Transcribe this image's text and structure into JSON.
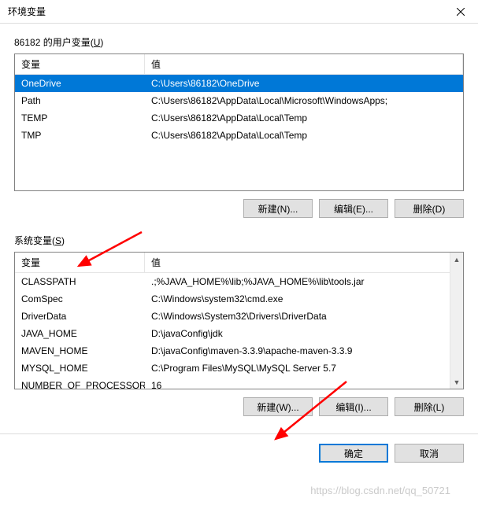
{
  "window": {
    "title": "环境变量"
  },
  "user_section": {
    "label_prefix": "86182 的用户变量(",
    "label_key": "U",
    "label_suffix": ")",
    "headers": {
      "name": "变量",
      "value": "值"
    },
    "rows": [
      {
        "name": "OneDrive",
        "value": "C:\\Users\\86182\\OneDrive",
        "selected": true
      },
      {
        "name": "Path",
        "value": "C:\\Users\\86182\\AppData\\Local\\Microsoft\\WindowsApps;",
        "selected": false
      },
      {
        "name": "TEMP",
        "value": "C:\\Users\\86182\\AppData\\Local\\Temp",
        "selected": false
      },
      {
        "name": "TMP",
        "value": "C:\\Users\\86182\\AppData\\Local\\Temp",
        "selected": false
      }
    ],
    "buttons": {
      "new": "新建(N)...",
      "edit": "编辑(E)...",
      "delete": "删除(D)"
    }
  },
  "system_section": {
    "label_prefix": "系统变量(",
    "label_key": "S",
    "label_suffix": ")",
    "headers": {
      "name": "变量",
      "value": "值"
    },
    "rows": [
      {
        "name": "CLASSPATH",
        "value": ".;%JAVA_HOME%\\lib;%JAVA_HOME%\\lib\\tools.jar"
      },
      {
        "name": "ComSpec",
        "value": "C:\\Windows\\system32\\cmd.exe"
      },
      {
        "name": "DriverData",
        "value": "C:\\Windows\\System32\\Drivers\\DriverData"
      },
      {
        "name": "JAVA_HOME",
        "value": "D:\\javaConfig\\jdk"
      },
      {
        "name": "MAVEN_HOME",
        "value": "D:\\javaConfig\\maven-3.3.9\\apache-maven-3.3.9"
      },
      {
        "name": "MYSQL_HOME",
        "value": "C:\\Program Files\\MySQL\\MySQL Server 5.7"
      },
      {
        "name": "NUMBER_OF_PROCESSORS",
        "value": "16"
      }
    ],
    "buttons": {
      "new": "新建(W)...",
      "edit": "编辑(I)...",
      "delete": "删除(L)"
    }
  },
  "dialog_buttons": {
    "ok": "确定",
    "cancel": "取消"
  },
  "watermark": "https://blog.csdn.net/qq_50721"
}
